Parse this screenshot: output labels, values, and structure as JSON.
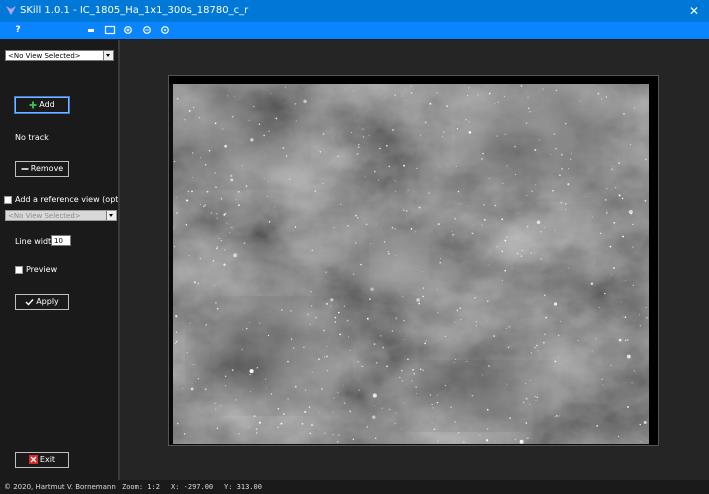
{
  "window": {
    "title": "SKill 1.0.1 - IC_1805_Ha_1x1_300s_18780_c_r",
    "close_glyph": "✕"
  },
  "toolbar": {
    "help_label": "?",
    "icons": [
      "minimize-view-icon",
      "restore-view-icon",
      "zoom-in-icon",
      "zoom-out-icon",
      "zoom-fit-icon"
    ]
  },
  "left_panel": {
    "view_select": {
      "value": "<No View Selected>"
    },
    "add_button": {
      "label": "Add"
    },
    "track_status": "No track",
    "remove_button": {
      "label": "Remove"
    },
    "reference_checkbox": {
      "label": "Add a reference view (opt.)",
      "checked": false
    },
    "reference_select": {
      "value": "<No View Selected>"
    },
    "line_width": {
      "label": "Line width",
      "value": "10"
    },
    "preview_checkbox": {
      "label": "Preview",
      "checked": false
    },
    "apply_button": {
      "label": "Apply"
    },
    "exit_button": {
      "label": "Exit"
    }
  },
  "status_bar": {
    "copyright": "© 2020, Hartmut V. Bornemann",
    "zoom": "Zoom: 1:2",
    "x": "X:  -297.00",
    "y": "Y:  313.00"
  },
  "colors": {
    "titlebar": "#0078d7",
    "toolbar": "#0a84ff",
    "panel": "#1a1a1a",
    "viewer": "#252525",
    "accent_add": "#37c85a",
    "exit_red": "#d42a2a"
  }
}
